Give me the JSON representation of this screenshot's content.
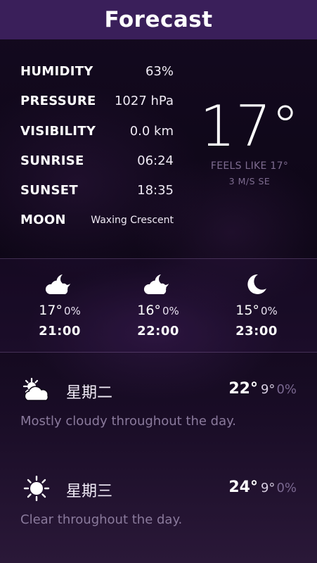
{
  "header": {
    "title": "Forecast"
  },
  "current": {
    "stats": [
      {
        "label": "HUMIDITY",
        "value": "63%"
      },
      {
        "label": "PRESSURE",
        "value": "1027 hPa"
      },
      {
        "label": "VISIBILITY",
        "value": "0.0 km"
      },
      {
        "label": "SUNRISE",
        "value": "06:24"
      },
      {
        "label": "SUNSET",
        "value": "18:35"
      },
      {
        "label": "MOON",
        "value": "Waxing Crescent"
      }
    ],
    "temperature": "17°",
    "feels_like": "FEELS LIKE 17°",
    "wind": "3 M/S SE"
  },
  "hourly": [
    {
      "icon": "partly-cloudy-night-icon",
      "temp": "17°",
      "pop": "0%",
      "time": "21:00"
    },
    {
      "icon": "partly-cloudy-night-icon",
      "temp": "16°",
      "pop": "0%",
      "time": "22:00"
    },
    {
      "icon": "moon-icon",
      "temp": "15°",
      "pop": "0%",
      "time": "23:00"
    }
  ],
  "daily": [
    {
      "icon": "partly-cloudy-day-icon",
      "name": "星期二",
      "max": "22°",
      "min": "9°",
      "pop": "0%",
      "summary": "Mostly cloudy throughout the day."
    },
    {
      "icon": "sun-icon",
      "name": "星期三",
      "max": "24°",
      "min": "9°",
      "pop": "0%",
      "summary": "Clear throughout the day."
    }
  ],
  "colors": {
    "header": "#3a1f5a",
    "muted": "#7e6c90",
    "background": "#0e0716"
  }
}
